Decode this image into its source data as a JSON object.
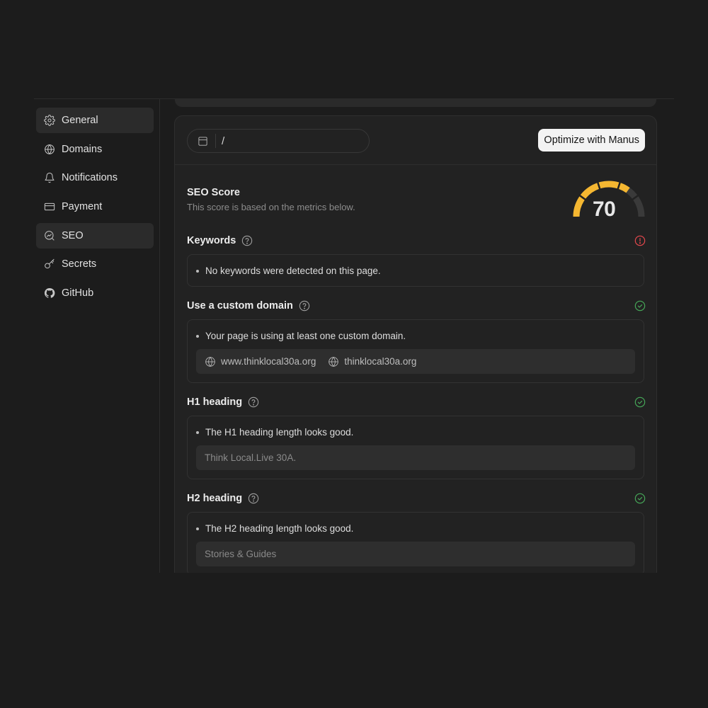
{
  "sidebar": {
    "items": [
      {
        "label": "General",
        "icon": "gear-icon"
      },
      {
        "label": "Domains",
        "icon": "globe-icon"
      },
      {
        "label": "Notifications",
        "icon": "bell-icon"
      },
      {
        "label": "Payment",
        "icon": "credit-card-icon"
      },
      {
        "label": "SEO",
        "icon": "seo-chart-icon"
      },
      {
        "label": "Secrets",
        "icon": "key-icon"
      },
      {
        "label": "GitHub",
        "icon": "github-icon"
      }
    ]
  },
  "toolbar": {
    "path_value": "/",
    "optimize_label": "Optimize with Manus"
  },
  "score": {
    "title": "SEO Score",
    "subtitle": "This score is based on the metrics below.",
    "value": "70",
    "fraction": 0.7,
    "color": "#f5b731",
    "track_color": "#3a3a3a"
  },
  "sections": {
    "keywords": {
      "label": "Keywords",
      "status": "error",
      "message": "No keywords were detected on this page."
    },
    "custom_domain": {
      "label": "Use a custom domain",
      "status": "ok",
      "message": "Your page is using at least one custom domain.",
      "domains": [
        "www.thinklocal30a.org",
        "thinklocal30a.org"
      ]
    },
    "h1": {
      "label": "H1 heading",
      "status": "ok",
      "message": "The H1 heading length looks good.",
      "value": "Think Local.Live 30A."
    },
    "h2": {
      "label": "H2 heading",
      "status": "ok",
      "message": "The H2 heading length looks good.",
      "value": "Stories & Guides"
    }
  },
  "colors": {
    "error": "#e5484d",
    "ok": "#46a758"
  }
}
